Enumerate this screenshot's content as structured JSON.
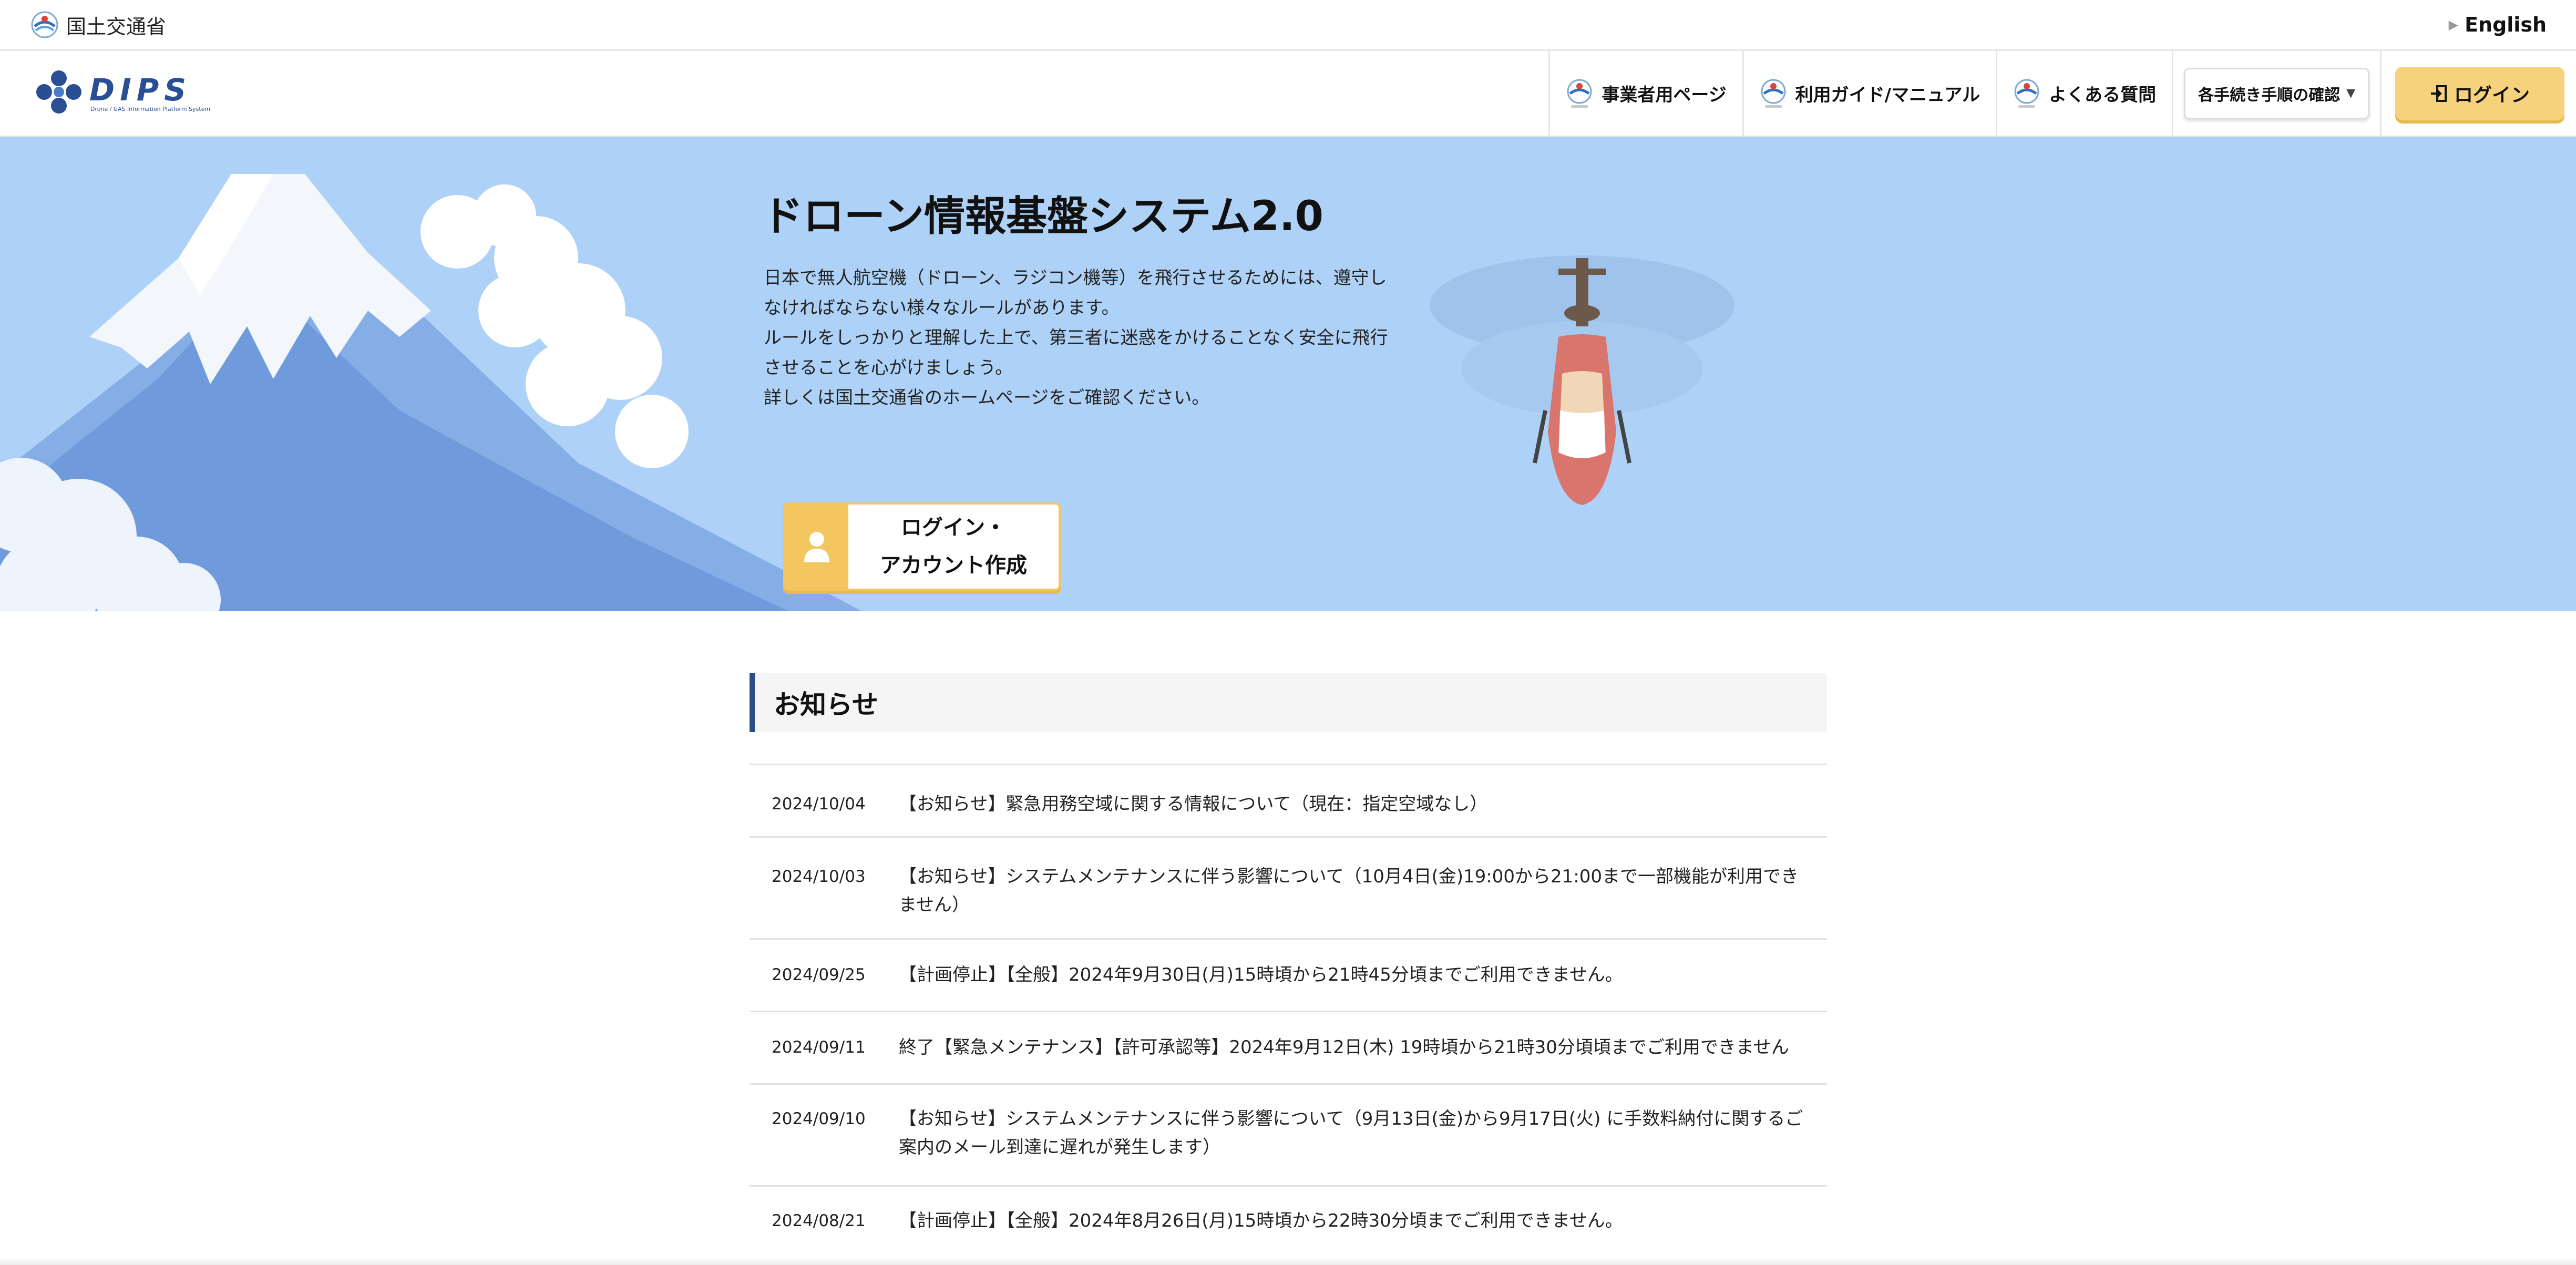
{
  "topbar": {
    "agency_name": "国土交通省",
    "language_link": "English"
  },
  "header": {
    "logo_text": "DIPS",
    "logo_tagline": "Drone / UAS Information Platform System",
    "nav": [
      {
        "label": "事業者用ページ"
      },
      {
        "label": "利用ガイド/マニュアル"
      },
      {
        "label": "よくある質問"
      }
    ],
    "procedures_dropdown": "各手続き手順の確認",
    "login_label": "ログイン"
  },
  "hero": {
    "title": "ドローン情報基盤システム2.0",
    "paragraph_lines": [
      "日本で無人航空機（ドローン、ラジコン機等）を飛行させるためには、遵守し",
      "なければならない様々なルールがあります。",
      "ルールをしっかりと理解した上で、第三者に迷惑をかけることなく安全に飛行",
      "させることを心がけましょう。",
      "詳しくは国土交通省のホームページをご確認ください。"
    ],
    "cta_line1": "ログイン・",
    "cta_line2": "アカウント作成"
  },
  "news": {
    "heading": "お知らせ",
    "items": [
      {
        "date": "2024/10/04",
        "text": "【お知らせ】緊急用務空域に関する情報について（現在：指定空域なし）"
      },
      {
        "date": "2024/10/03",
        "text": "【お知らせ】システムメンテナンスに伴う影響について（10月4日(金)19:00から21:00まで一部機能が利用できません）"
      },
      {
        "date": "2024/09/25",
        "text": "【計画停止】【全般】2024年9月30日(月)15時頃から21時45分頃までご利用できません。"
      },
      {
        "date": "2024/09/11",
        "text": "終了【緊急メンテナンス】【許可承認等】2024年9月12日(木) 19時頃から21時30分頃頃までご利用できません"
      },
      {
        "date": "2024/09/10",
        "text": "【お知らせ】システムメンテナンスに伴う影響について（9月13日(金)から9月17日(火) に手数料納付に関するご案内のメール到達に遅れが発生します）"
      },
      {
        "date": "2024/08/21",
        "text": "【計画停止】【全般】2024年8月26日(月)15時頃から22時30分頃までご利用できません。"
      }
    ]
  },
  "colors": {
    "hero_background": "#aed1f7",
    "login_button": "#f6d27c",
    "news_accent": "#2c4d8c"
  }
}
